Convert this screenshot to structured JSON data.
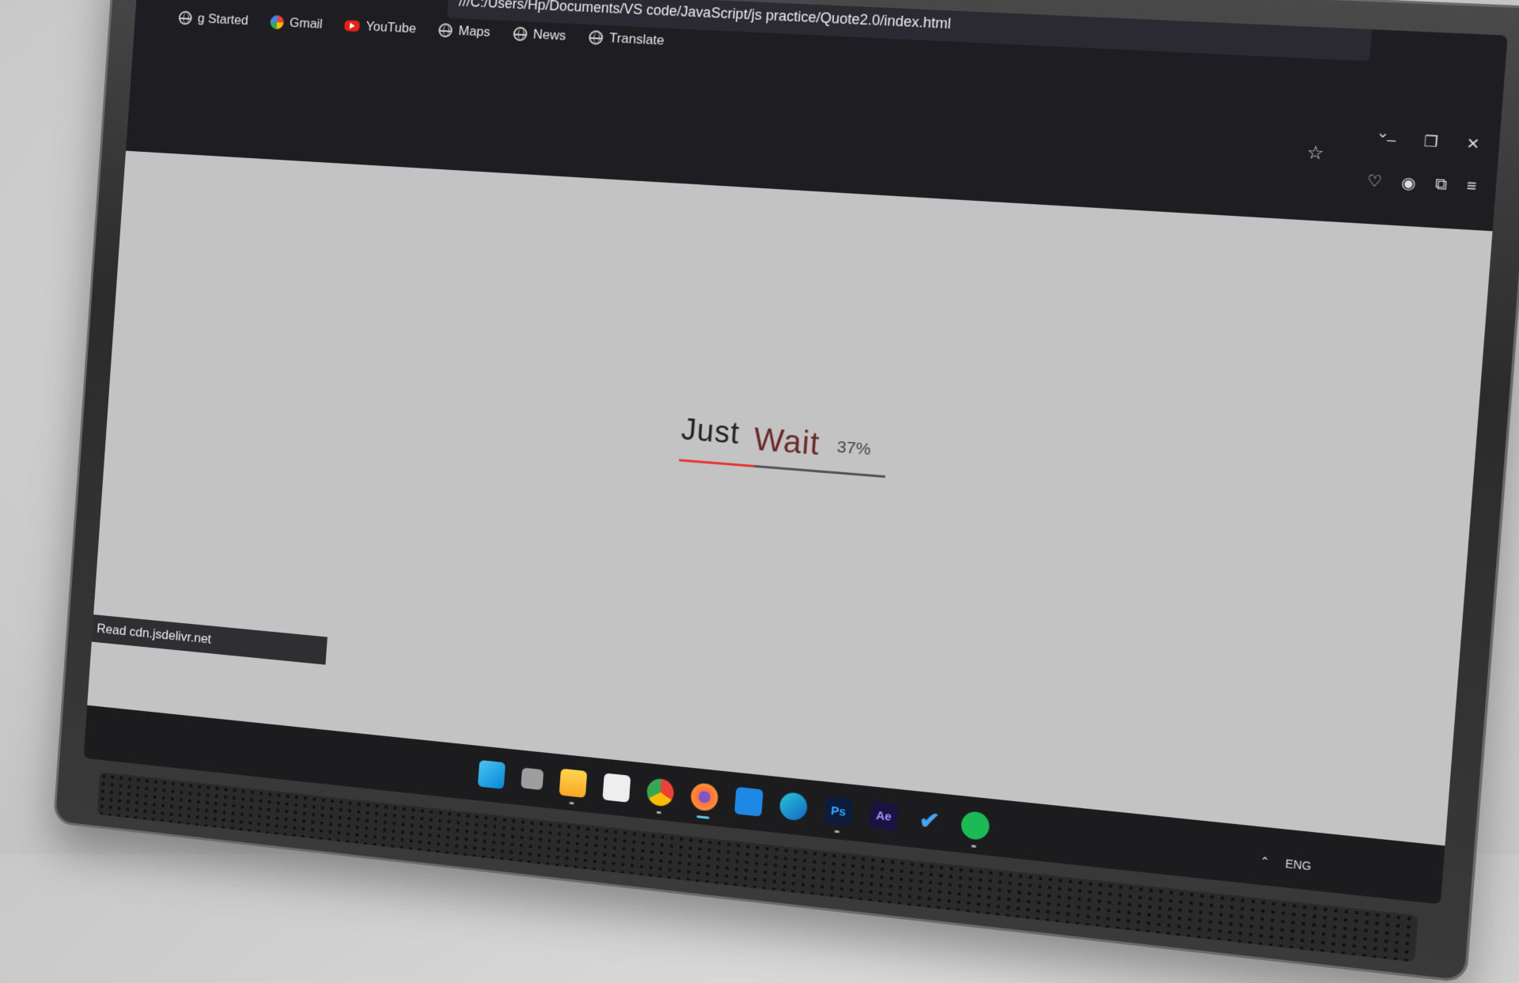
{
  "browser": {
    "url": "///C:/Users/Hp/Documents/VS code/JavaScript/js practice/Quote2.0/index.html",
    "bookmarks": [
      {
        "label": "g Started",
        "icon": "firefox-icon"
      },
      {
        "label": "Gmail",
        "icon": "google-icon"
      },
      {
        "label": "YouTube",
        "icon": "youtube-icon"
      },
      {
        "label": "Maps",
        "icon": "globe-icon"
      },
      {
        "label": "News",
        "icon": "globe-icon"
      },
      {
        "label": "Translate",
        "icon": "globe-icon"
      }
    ],
    "status_text": "Read cdn.jsdelivr.net"
  },
  "loader": {
    "word1": "Just",
    "word2": "Wait",
    "percent_text": "37%",
    "progress": 0.37,
    "accent": "#e53935"
  },
  "taskbar": {
    "apps": [
      "windows-start-icon",
      "task-view-icon",
      "file-explorer-icon",
      "microsoft-store-icon",
      "chrome-icon",
      "firefox-icon",
      "vscode-icon",
      "edge-icon",
      "photoshop-icon",
      "after-effects-icon",
      "todo-icon",
      "spotify-icon"
    ],
    "photoshop_label": "Ps",
    "after_effects_label": "Ae",
    "language": "ENG"
  }
}
